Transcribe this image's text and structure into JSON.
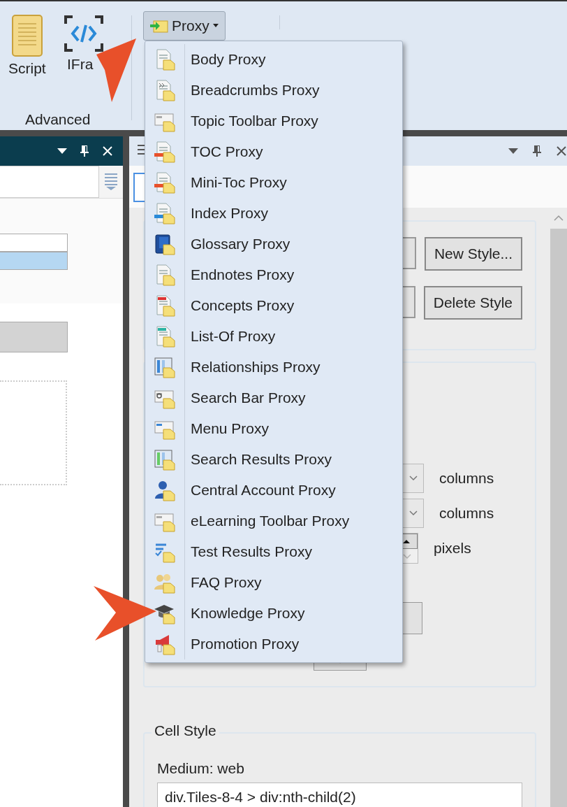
{
  "ribbon": {
    "items": [
      {
        "label": "Script"
      },
      {
        "label": "IFra"
      }
    ],
    "group_label": "Advanced",
    "proxy_button": {
      "label": "Proxy"
    }
  },
  "proxy_menu": {
    "items": [
      {
        "label": "Body Proxy"
      },
      {
        "label": "Breadcrumbs Proxy"
      },
      {
        "label": "Topic Toolbar Proxy"
      },
      {
        "label": "TOC Proxy"
      },
      {
        "label": "Mini-Toc Proxy"
      },
      {
        "label": "Index Proxy"
      },
      {
        "label": "Glossary Proxy"
      },
      {
        "label": "Endnotes Proxy"
      },
      {
        "label": "Concepts Proxy"
      },
      {
        "label": "List-Of Proxy"
      },
      {
        "label": "Relationships Proxy"
      },
      {
        "label": "Search Bar Proxy"
      },
      {
        "label": "Menu Proxy"
      },
      {
        "label": "Search Results Proxy"
      },
      {
        "label": "Central Account Proxy"
      },
      {
        "label": "eLearning Toolbar Proxy"
      },
      {
        "label": "Test Results Proxy"
      },
      {
        "label": "FAQ Proxy"
      },
      {
        "label": "Knowledge Proxy"
      },
      {
        "label": "Promotion Proxy"
      }
    ]
  },
  "left_pane": {
    "rows": [
      {
        "selected": false
      },
      {
        "selected": true
      }
    ]
  },
  "styles_group": {
    "buttons": [
      {
        "label": "New Style..."
      },
      {
        "label": "Delete Style"
      }
    ]
  },
  "layout_group": {
    "units": [
      {
        "kind": "dropdown",
        "label": "columns"
      },
      {
        "kind": "dropdown",
        "label": "columns"
      },
      {
        "kind": "spinner",
        "label": "pixels"
      }
    ]
  },
  "cell_style": {
    "legend": "Cell Style",
    "medium": "Medium: web",
    "selector": "div.Tiles-8-4 > div:nth-child(2)"
  }
}
